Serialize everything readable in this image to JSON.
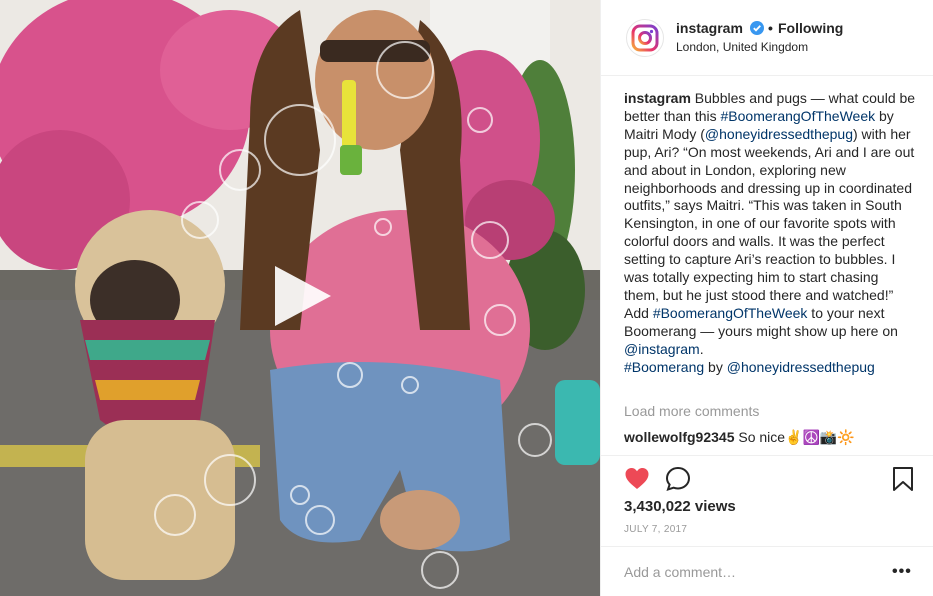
{
  "header": {
    "username": "instagram",
    "separator": "•",
    "follow_status": "Following",
    "location": "London, United Kingdom"
  },
  "caption": {
    "username": "instagram",
    "part1": " Bubbles and pugs — what could be better than this ",
    "tag1": "#BoomerangOfTheWeek",
    "part2": " by Maitri Mody (",
    "mention1": "@honeyidressedthepug",
    "part3": ") with her pup, Ari? “On most weekends, Ari and I are out and about in London, exploring new neighborhoods and dressing up in coordinated outfits,” says Maitri. “This was taken in South Kensington, in one of our favorite spots with colorful doors and walls. It was the perfect setting to capture Ari’s reaction to bubbles. I was totally expecting him to start chasing them, but he just stood there and watched!” Add ",
    "tag2": "#BoomerangOfTheWeek",
    "part4": " to your next Boomerang — yours might show up here on ",
    "mention2": "@instagram",
    "part5": ".",
    "tag3": "#Boomerang",
    "part6": " by ",
    "mention3": "@honeyidressedthepug"
  },
  "comments": {
    "load_more": "Load more comments",
    "items": [
      {
        "username": "wollewolfg92345",
        "text": " So nice✌️☮️📸🔆"
      }
    ]
  },
  "stats": {
    "views": "3,430,022 views",
    "date": "JULY 7, 2017"
  },
  "add_comment": {
    "placeholder": "Add a comment…",
    "more": "•••"
  },
  "icons": [
    "instagram-logo-icon",
    "verified-icon",
    "play-icon",
    "heart-icon",
    "comment-icon",
    "bookmark-icon",
    "more-options-icon"
  ],
  "colors": {
    "heart": "#ed4956",
    "link": "#003569",
    "verified": "#3897f0",
    "muted": "#999999"
  }
}
